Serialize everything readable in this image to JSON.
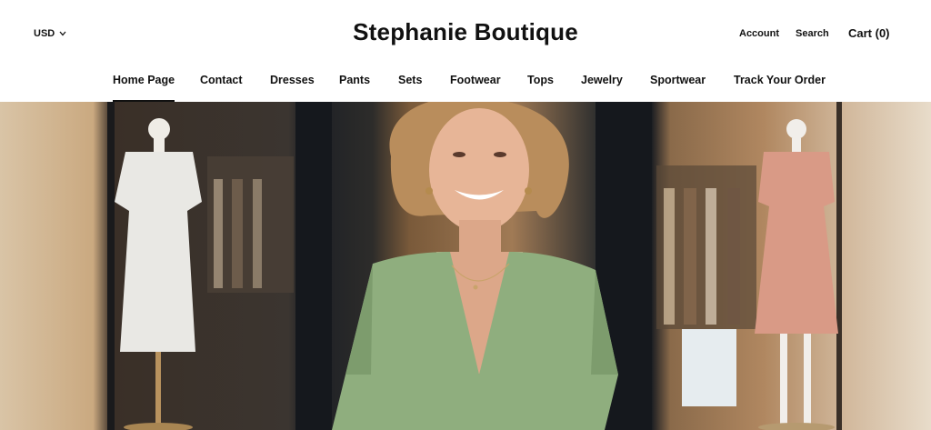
{
  "header": {
    "currency": "USD",
    "brand": "Stephanie Boutique",
    "account": "Account",
    "search": "Search",
    "cart": "Cart (0)"
  },
  "nav": {
    "items": [
      {
        "label": "Home Page",
        "active": true
      },
      {
        "label": "Contact"
      },
      {
        "label": "Dresses"
      },
      {
        "label": "Pants"
      },
      {
        "label": "Sets"
      },
      {
        "label": "Footwear"
      },
      {
        "label": "Tops"
      },
      {
        "label": "Jewelry"
      },
      {
        "label": "Sportwear"
      },
      {
        "label": "Track Your Order"
      }
    ]
  },
  "colors": {
    "text": "#111111",
    "background": "#ffffff",
    "blouse": "#8fae7e",
    "dress_pink": "#d99a86",
    "dress_white": "#e9e8e4"
  },
  "hero": {
    "icon": "hero-image",
    "subject": "smiling-woman-in-front-of-boutique"
  }
}
